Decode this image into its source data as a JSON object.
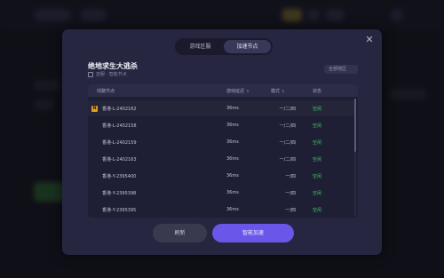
{
  "tabs": [
    {
      "label": "游戏区服",
      "active": false
    },
    {
      "label": "加速节点",
      "active": true
    }
  ],
  "game": {
    "title": "绝地求生大逃杀",
    "subtitle": "亚服 · 智能节点"
  },
  "region_select": {
    "value": "全部地区"
  },
  "table": {
    "headers": {
      "node": "线路节点",
      "latency": "游戏延迟",
      "mode": "模式",
      "status": "状态"
    },
    "rows": [
      {
        "node": "香港-L-2402162",
        "latency": "36ms",
        "mode": "一/二/四",
        "status": "空闲",
        "badge": "N",
        "selected": true
      },
      {
        "node": "香港-L-2402158",
        "latency": "36ms",
        "mode": "一/二/四",
        "status": "空闲"
      },
      {
        "node": "香港-L-2402159",
        "latency": "36ms",
        "mode": "一/二/四",
        "status": "空闲"
      },
      {
        "node": "香港-L-2402163",
        "latency": "36ms",
        "mode": "一/二/四",
        "status": "空闲"
      },
      {
        "node": "香港-Y-2395400",
        "latency": "36ms",
        "mode": "一/四",
        "status": "空闲"
      },
      {
        "node": "香港-Y-2395398",
        "latency": "36ms",
        "mode": "一/四",
        "status": "空闲"
      },
      {
        "node": "香港-Y-2395395",
        "latency": "36ms",
        "mode": "一/四",
        "status": "空闲"
      }
    ]
  },
  "buttons": {
    "refresh": "刷新",
    "connect": "智能加速"
  },
  "colors": {
    "accent": "#6a56e8",
    "status_green": "#3fcf5c",
    "badge": "#e0a020"
  }
}
